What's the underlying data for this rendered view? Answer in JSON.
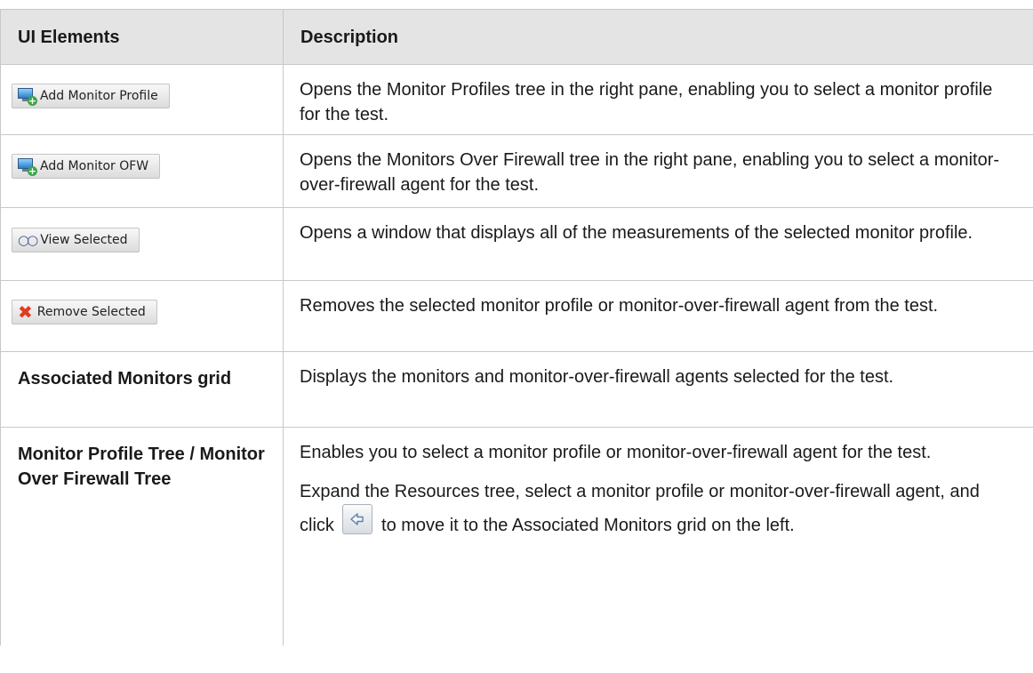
{
  "header": {
    "col1": "UI Elements",
    "col2": "Description"
  },
  "rows": [
    {
      "element": {
        "type": "button",
        "label": "Add Monitor Profile",
        "icon": "add-monitor-icon"
      },
      "description": "Opens the Monitor Profiles tree in the right pane, enabling you to select a monitor profile for the test."
    },
    {
      "element": {
        "type": "button",
        "label": "Add Monitor OFW",
        "icon": "add-monitor-icon"
      },
      "description": "Opens the Monitors Over Firewall tree in the right pane, enabling you to select a monitor-over-firewall agent for the test."
    },
    {
      "element": {
        "type": "button",
        "label": "View Selected",
        "icon": "glasses-icon"
      },
      "description": "Opens a window that displays all of the measurements of the selected monitor profile."
    },
    {
      "element": {
        "type": "button",
        "label": "Remove Selected",
        "icon": "red-x-icon"
      },
      "description": "Removes the selected monitor profile or monitor-over-firewall agent from the test."
    },
    {
      "element": {
        "type": "text",
        "label": "Associated Monitors grid"
      },
      "description": "Displays the monitors and monitor-over-firewall agents selected for the test."
    },
    {
      "element": {
        "type": "text",
        "label": "Monitor Profile Tree / Monitor Over Firewall Tree"
      },
      "description": "Enables you to select a monitor profile or monitor-over-firewall agent for the test.",
      "description_para2_before": "Expand the Resources tree, select a monitor profile or monitor-over-firewall agent, and click",
      "description_para2_after": "to move it to the Associated Monitors grid on the left.",
      "inline_icon": "left-arrow-icon"
    }
  ]
}
